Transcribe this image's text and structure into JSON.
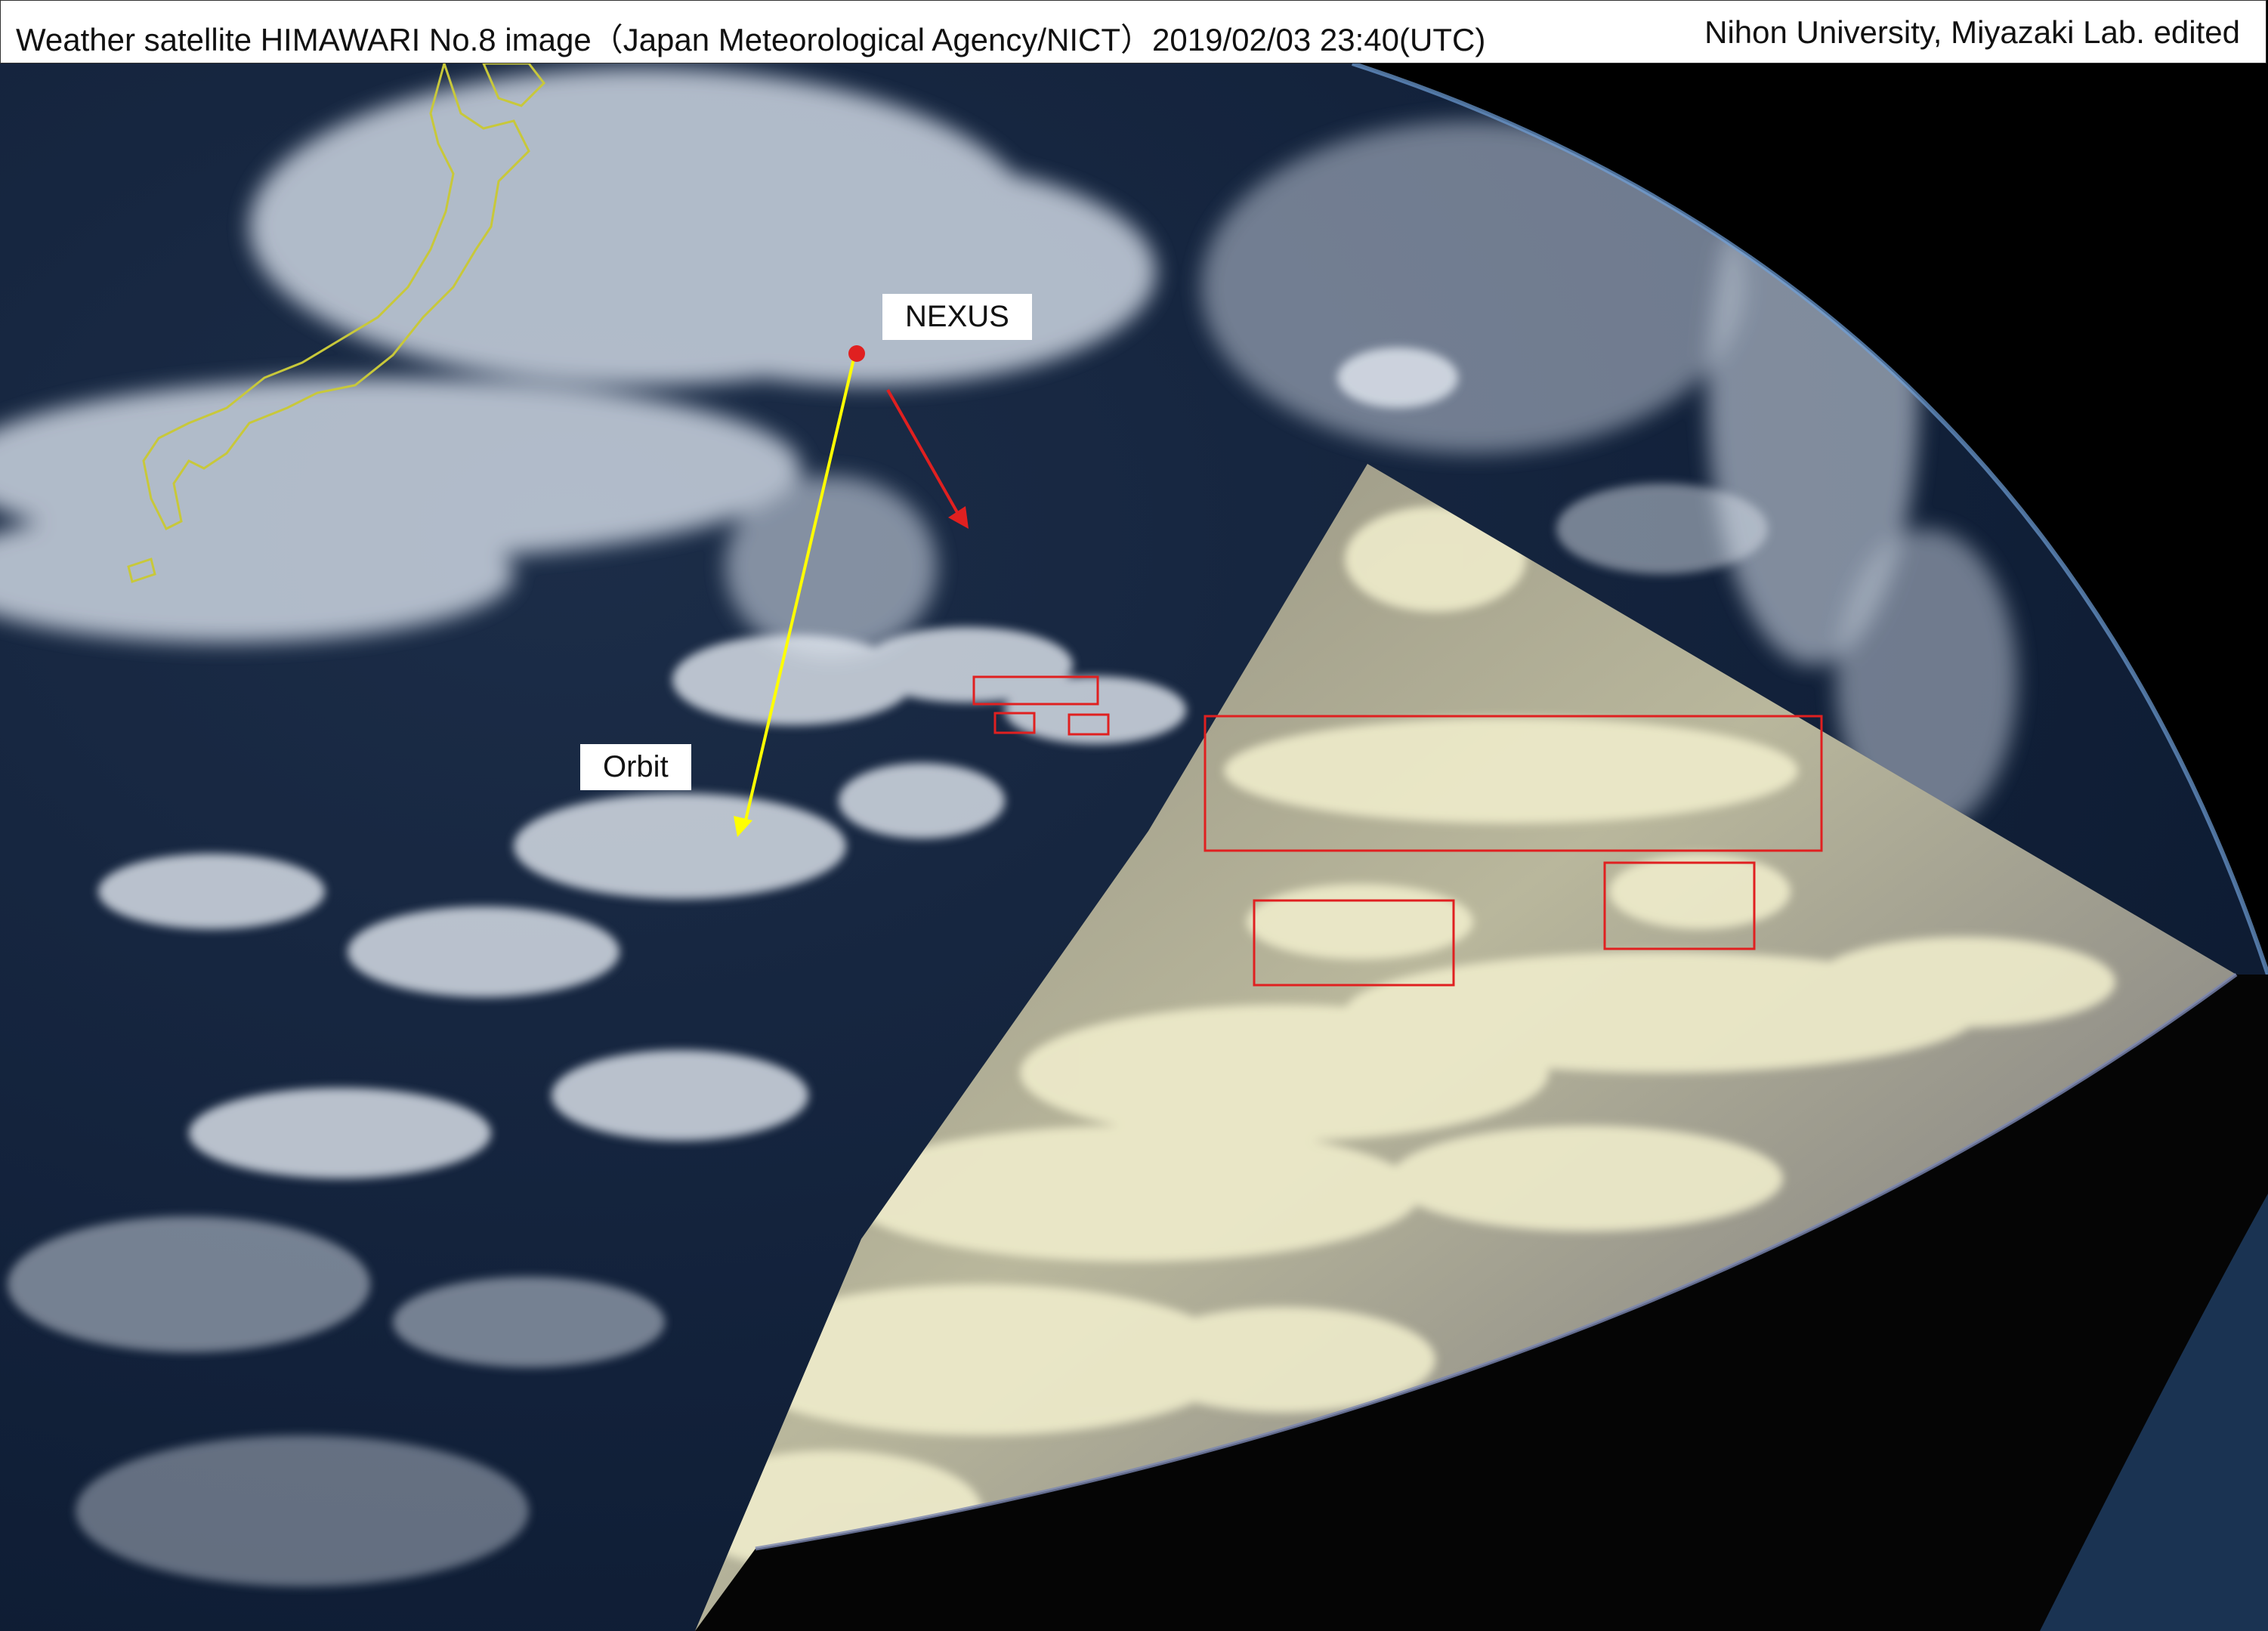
{
  "header": {
    "left_text": "Weather satellite HIMAWARI No.8 image（Japan Meteorological Agency/NICT）2019/02/03 23:40(UTC)",
    "right_text": "Nihon University, Miyazaki Lab. edited"
  },
  "annotations": {
    "nexus_label": "NEXUS",
    "orbit_label": "Orbit"
  },
  "colors": {
    "coastline": "#c8c83a",
    "orbit_arrow": "#ffff00",
    "drift_arrow": "#e02020",
    "highlight_boxes": "#e02020",
    "ocean": "#142238",
    "space": "#000000",
    "clouds": "#dfe6ef",
    "inset_clouds": "#e8e6c4"
  }
}
